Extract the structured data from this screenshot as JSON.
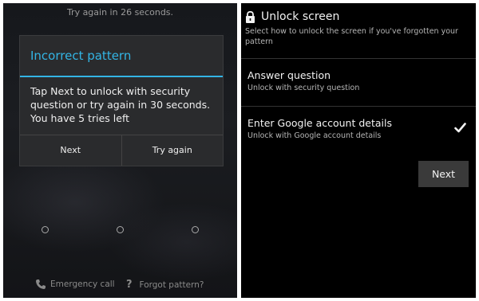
{
  "lock_screen": {
    "countdown": "Try again in 26 seconds.",
    "dialog": {
      "title": "Incorrect pattern",
      "message": "Tap Next to unlock with security question or try again in 30 seconds. You have 5 tries left",
      "next_label": "Next",
      "try_again_label": "Try again"
    },
    "emergency_call": "Emergency call",
    "forgot_pattern": "Forgot pattern?"
  },
  "unlock_screen": {
    "title": "Unlock screen",
    "description": "Select how to unlock the screen if you've forgotten your pattern",
    "options": [
      {
        "title": "Answer question",
        "subtitle": "Unlock with security question"
      },
      {
        "title": "Enter Google account details",
        "subtitle": "Unlock with Google account details"
      }
    ],
    "next_label": "Next"
  },
  "colors": {
    "accent": "#33b5e5",
    "text_primary": "#f2f2f2",
    "text_secondary": "#b5b5b5"
  }
}
